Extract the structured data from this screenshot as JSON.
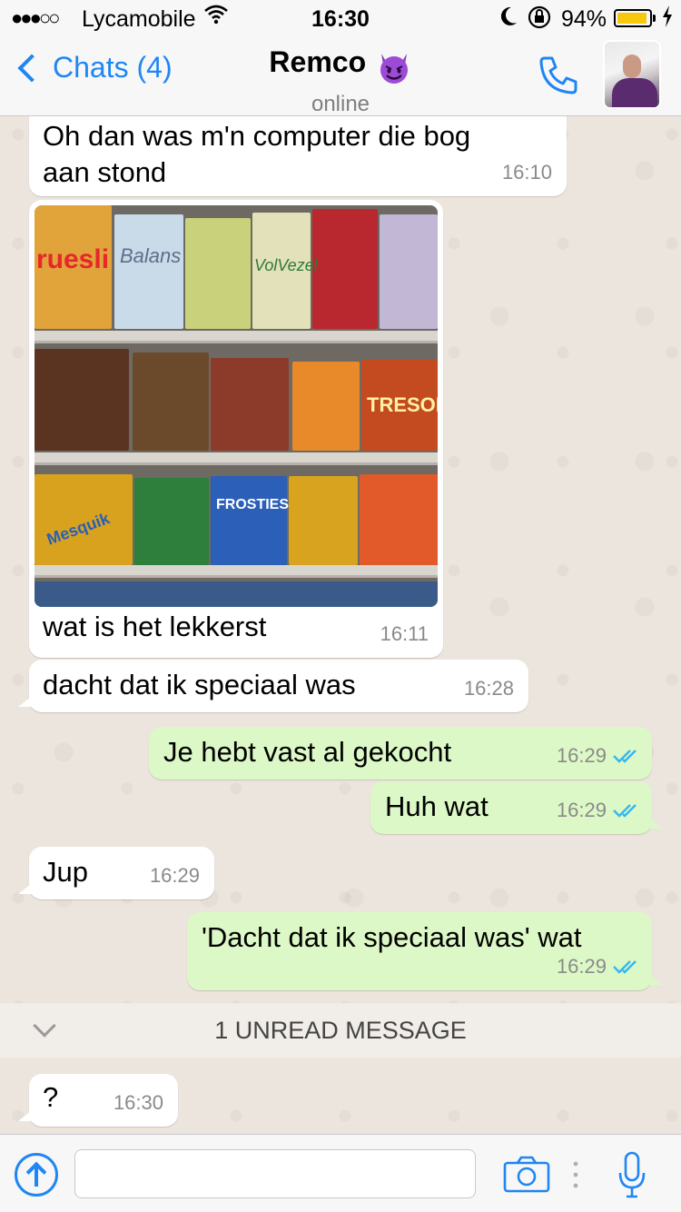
{
  "status_bar": {
    "signal": "●●●○○",
    "carrier": "Lycamobile",
    "time": "16:30",
    "battery": "94%",
    "battery_level": 0.94
  },
  "header": {
    "back_label": "Chats (4)",
    "contact_name": "Remco",
    "contact_status": "online"
  },
  "messages": [
    {
      "dir": "in",
      "text_lines": [
        "Oh dan was m'n computer die bog",
        "aan stond"
      ],
      "time": "16:10"
    },
    {
      "dir": "in",
      "type": "image",
      "caption": "wat is het lekkerst",
      "time": "16:11"
    },
    {
      "dir": "in",
      "text": "dacht dat ik speciaal was",
      "time": "16:28"
    },
    {
      "dir": "out",
      "text": "Je hebt vast al gekocht",
      "time": "16:29",
      "read": true
    },
    {
      "dir": "out",
      "text": "Huh wat",
      "time": "16:29",
      "read": true
    },
    {
      "dir": "in",
      "text": "Jup",
      "time": "16:29"
    },
    {
      "dir": "out",
      "text": "'Dacht dat ik speciaal was' wat",
      "time": "16:29",
      "read": true
    },
    {
      "dir": "in",
      "text": "?",
      "time": "16:30"
    }
  ],
  "unread_banner": "1 UNREAD MESSAGE",
  "composer": {
    "value": ""
  },
  "image_labels": [
    "ruesli",
    "Balans",
    "VolVezel",
    "TRESOR",
    "FROSTIES",
    "Mesquik"
  ],
  "colors": {
    "accent": "#1f86f4",
    "outgoing_bubble": "#dcf8c6",
    "incoming_bubble": "#ffffff",
    "read_ticks": "#34b7f1",
    "background": "#ece5dd"
  }
}
